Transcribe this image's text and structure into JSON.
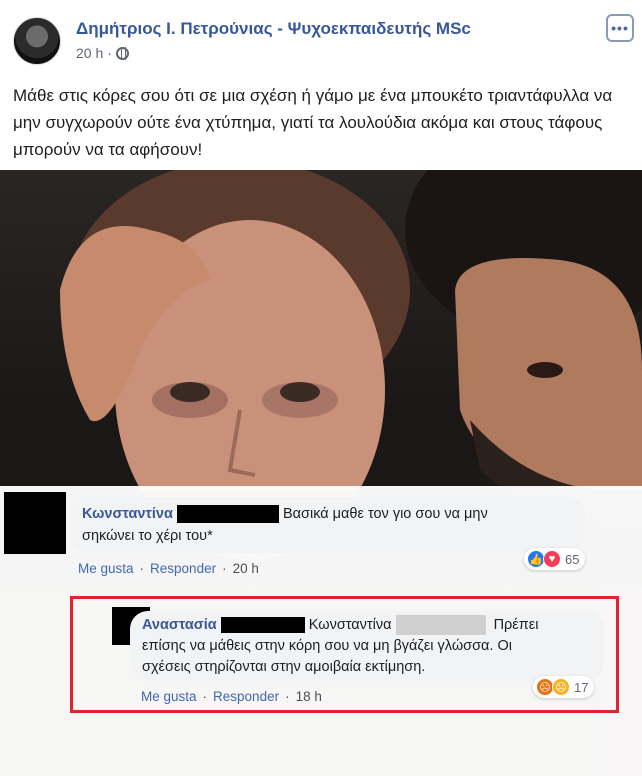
{
  "post": {
    "author": "Δημήτριος Ι. Πετρούνιας - Ψυχοεκπαιδευτής MSc",
    "time": "20 h",
    "separator": "·",
    "text": "Μάθε στις κόρες σου ότι σε μια σχέση ή γάμο με ένα μπουκέτο τριαντάφυλλα να μην συγχωρούν ούτε ένα χτύπημα, γιατί τα λουλούδια ακόμα και στους τάφους μπορούν να τα αφήσουν!",
    "more_label": "•••"
  },
  "comments": [
    {
      "name": "Κωνσταντίνα",
      "text_line1": "Βασικά μαθε τον γιο σου να μην",
      "text_line2": "σηκώνει το χέρι του*",
      "like_label": "Me gusta",
      "reply_label": "Responder",
      "time": "20 h",
      "reaction_count": "65",
      "reaction_icons": [
        "like-icon",
        "love-icon"
      ]
    },
    {
      "name": "Αναστασία",
      "mention": "Κωνσταντίνα",
      "text_lead": "Πρέπει",
      "text_line2": "επίσης να μάθεις στην κόρη σου να μη βγάζει γλώσσα. Οι",
      "text_line3": "σχέσεις στηρίζονται στην αμοιβαία εκτίμηση.",
      "like_label": "Me gusta",
      "reply_label": "Responder",
      "time": "18 h",
      "reaction_count": "17",
      "reaction_icons": [
        "angry-icon",
        "sad-icon"
      ]
    }
  ],
  "colors": {
    "link_blue": "#385898",
    "highlight_red": "#e0242f",
    "bubble_bg": "#f2f3f5"
  }
}
